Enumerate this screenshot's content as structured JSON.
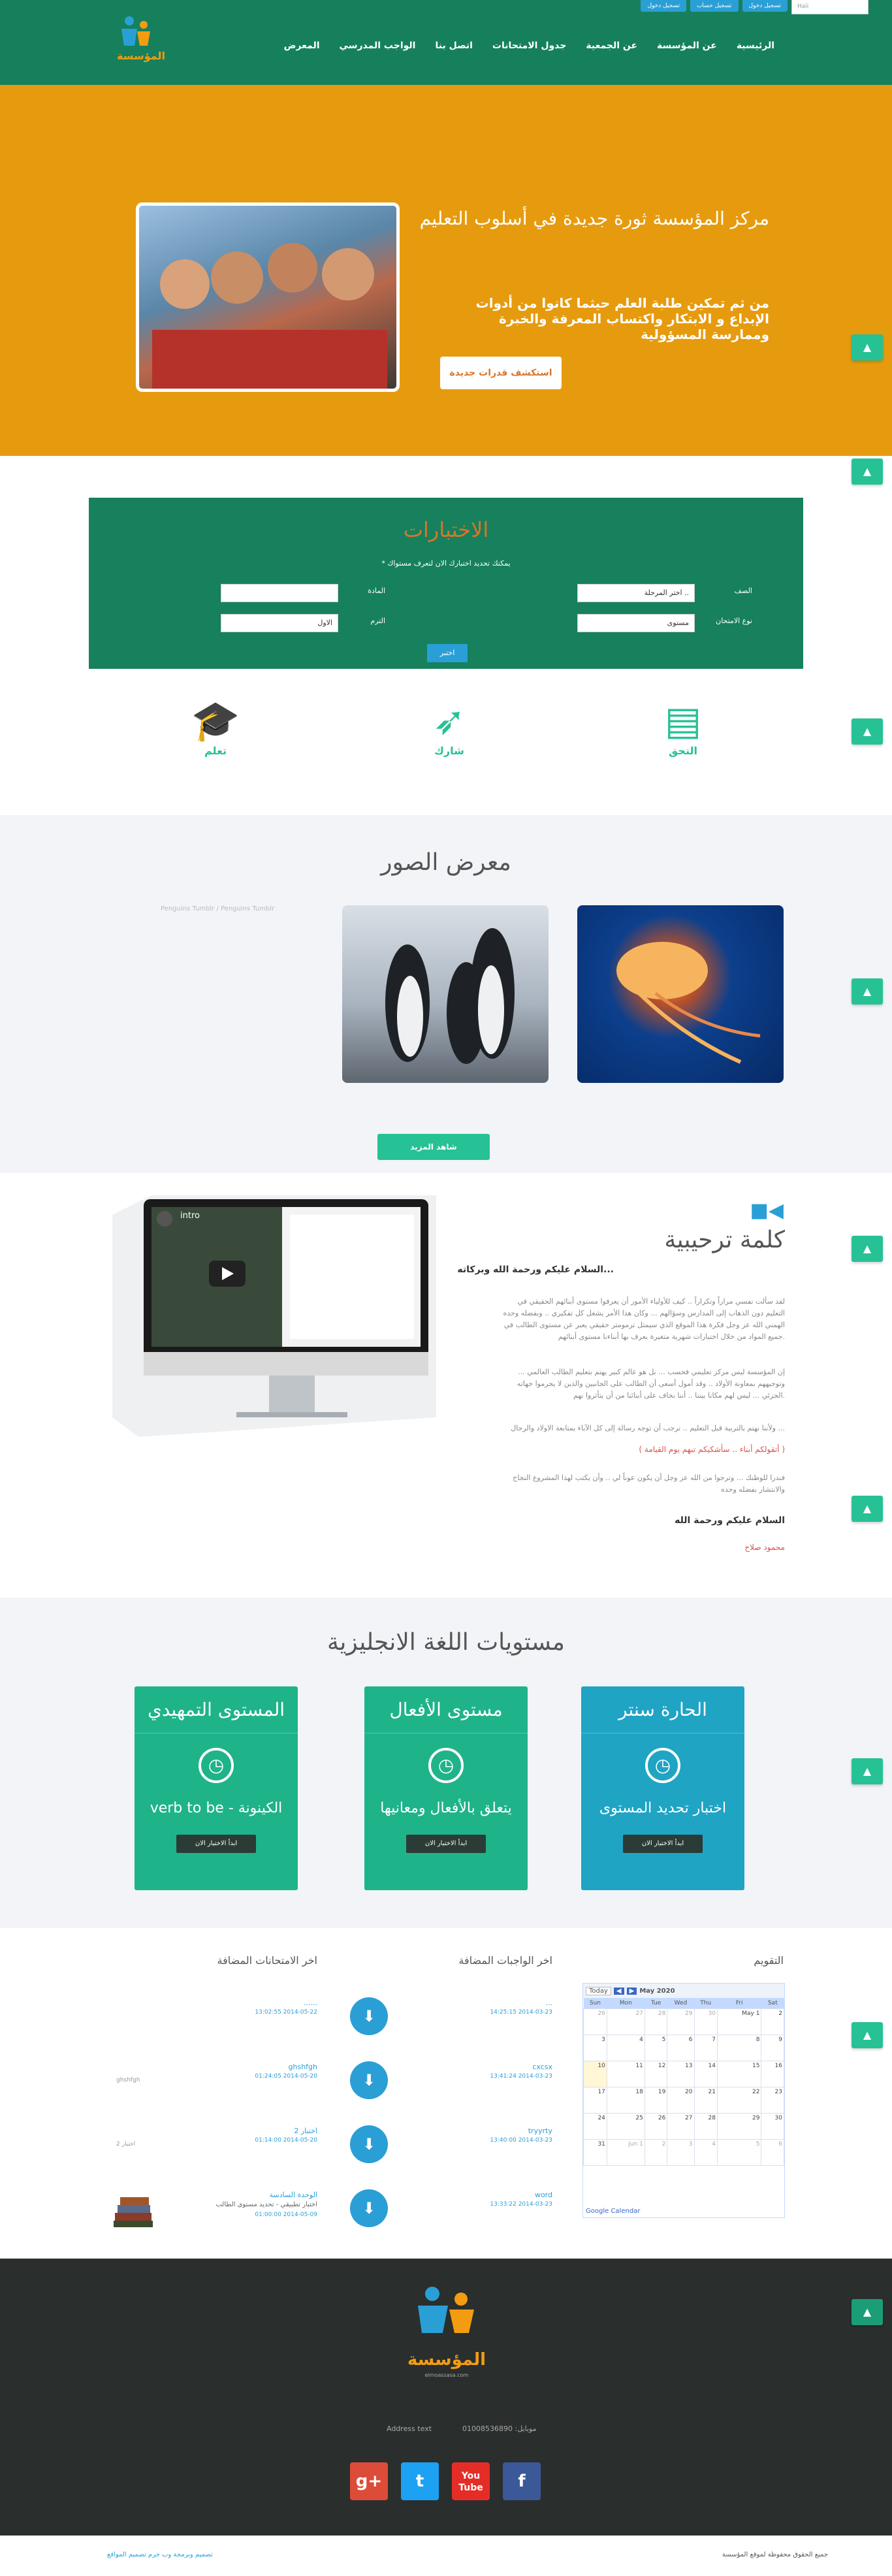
{
  "topbar": {
    "search_value": "Haii",
    "buttons": [
      "تسجيل دخول",
      "تسجيل حساب",
      "تسجيل دخول"
    ]
  },
  "nav": [
    "الرئيسية",
    "عن المؤسسة",
    "عن الجمعية",
    "جدول الامتحانات",
    "اتصل بنا",
    "الواجب المدرسي",
    "المعرض"
  ],
  "logo": {
    "text": "المؤسسة"
  },
  "hero": {
    "title": "مركز المؤسسة ثورة جديدة في أسلوب التعليم",
    "subtitle": "من ثم تمكين طلبة العلم حيثما كانوا من أدوات الإبداع و الابتكار واكتساب المعرفة والخبرة وممارسة المسؤولية",
    "button": "استكشف قدرات جديدة"
  },
  "exam": {
    "title": "الاختبارات",
    "hint": "* يمكنك تحديد اختبارك الان لتعرف مستواك",
    "labels": {
      "grade": "الصف",
      "subject": "المادة",
      "type": "نوع الامتحان",
      "term": "الترم"
    },
    "values": {
      "grade": "اختر المرحلة ..",
      "subject": "",
      "type": "مستوى",
      "term": "الاول"
    },
    "button": "اختبر"
  },
  "features": [
    {
      "label": "التحق",
      "icon": "book-icon"
    },
    {
      "label": "شارك",
      "icon": "rocket-icon"
    },
    {
      "label": "تعلم",
      "icon": "graduation-cap-icon"
    }
  ],
  "gallery": {
    "title": "معرض الصور",
    "broken_alt": "Penguins Tumblr / Penguins Tumblr",
    "button": "شاهد المزيد"
  },
  "welcome": {
    "title": "كلمة ترحيبية",
    "greeting": "السلام عليكم ورحمة الله وبركاته...",
    "p1": "لقد سألت نفسي مراراً وتكراراً .. كيف للأولياء الأمور أن يعرفوا مستوى أبنائهم الحقيقي في التعليم دون الذهاب إلى المدارس وسؤالهم ... وكان هذا الأمر يشغل كل تفكيري .. وبفضله وحده الهمني الله عز وجل فكرة هذا الموقع الذي سيمثل ترمومتر حقيقي يعبر عن مستوى الطالب في جميع المواد من خلال اختبارات شهرية متغيرة يعرف بها أبناءنا مستوى أبنائهم.",
    "p2": "إن المؤسسة ليس مركز تعليمي فحسب ... بل هو عالم كبير يهتم بتعليم الطالب العالمي ... وتوجيههم بمعاونة الأولاد .. وقد أمول أسعى أن الطالب على الجانبين والذين لا يحرموا جهاته الجزئي ... ليس لهم مكانا بيننا .. أننا نخاف على أبنائنا من أن يتأثروا بهم.",
    "p3": "ولأننا نهتم بالتربية قبل التعليم .. نرجب أن توجه رسالة إلى كل الآباء بمتابعة الاولاد والرجال ...",
    "quote": "( أتقولكم أبناء .. سأشكيكم تبهم يوم القيامة )",
    "p4": "فندرا للوطنك ... وترجوا من الله عز وجل أن يكون عوناً لي .. وأن يكتب لهذا المشروع النجاح والانتشار بفضله وحده",
    "signoff": "السلام عليكم ورحمة الله",
    "author": "محمود صلاح",
    "video_title": "intro"
  },
  "levels": {
    "title": "مستويات اللغة الانجليزية",
    "cards": [
      {
        "header": "الحارة سنتر",
        "text": "اختبار تحديد المستوى",
        "button": "ابدأ الاختبار الان",
        "color": "#1fa4c4"
      },
      {
        "header": "مستوى الأفعال",
        "text": "يتعلق بالأفعال ومعانيها",
        "button": "ابدأ الاختبار الان",
        "color": "#1fb38a"
      },
      {
        "header": "المستوى التمهيدي",
        "text": "verb to be - الكينونة",
        "button": "ابدأ الاختبار الان",
        "color": "#1fb38a"
      }
    ]
  },
  "calendar": {
    "title": "التقويم",
    "today": "Today",
    "month": "May 2020",
    "days": [
      "Sun",
      "Mon",
      "Tue",
      "Wed",
      "Thu",
      "Fri",
      "Sat"
    ],
    "weeks": [
      [
        "26",
        "27",
        "28",
        "29",
        "30",
        "May 1",
        "2"
      ],
      [
        "3",
        "4",
        "5",
        "6",
        "7",
        "8",
        "9"
      ],
      [
        "10",
        "11",
        "12",
        "13",
        "14",
        "15",
        "16"
      ],
      [
        "17",
        "18",
        "19",
        "20",
        "21",
        "22",
        "23"
      ],
      [
        "24",
        "25",
        "26",
        "27",
        "28",
        "29",
        "30"
      ],
      [
        "31",
        "Jun 1",
        "2",
        "3",
        "4",
        "5",
        "6"
      ]
    ],
    "footer": "Google Calendar"
  },
  "homework": {
    "title": "اخر الواجبات المضافة",
    "items": [
      {
        "title": "...",
        "date": "14:25:15 2014-03-23"
      },
      {
        "title": "cxcsx",
        "date": "13:41:24 2014-03-23"
      },
      {
        "title": "tryyrty",
        "date": "13:40:00 2014-03-23"
      },
      {
        "title": "word",
        "date": "13:33:22 2014-03-23"
      }
    ]
  },
  "exams": {
    "title": "اخر الامتحانات المضافة",
    "items": [
      {
        "title": "......",
        "date": "13:02:55 2014-05-22",
        "side": ""
      },
      {
        "title": "ghshfgh",
        "date": "01:24:05 2014-05-20",
        "side": "ghshfgh"
      },
      {
        "title": "اختبار 2",
        "date": "01:14:00 2014-05-20",
        "side": "اختبار 2"
      },
      {
        "title": "الوحدة السادسة",
        "date": "01:00:00 2014-05-09",
        "side": "اختبار تطبيقي - تحديد مستوى الطالب"
      }
    ]
  },
  "footer": {
    "logo_text": "المؤسسة",
    "logo_sub": "elmoassasa.com",
    "phone_label": "موبايل:",
    "phone": "01008536890",
    "address": "Address text",
    "social": [
      {
        "name": "google-plus-icon",
        "glyph": "g+",
        "color": "#dd4b39"
      },
      {
        "name": "twitter-icon",
        "glyph": "t",
        "color": "#1da1f2"
      },
      {
        "name": "youtube-icon",
        "glyph": "You Tube",
        "color": "#e52d27"
      },
      {
        "name": "facebook-icon",
        "glyph": "f",
        "color": "#3b5998"
      }
    ]
  },
  "bottom": {
    "right": "جميع الحقوق محفوظة لموقع المؤسسة",
    "left": "تصميم وبرمجة وب حرم تصميم المواقع"
  }
}
